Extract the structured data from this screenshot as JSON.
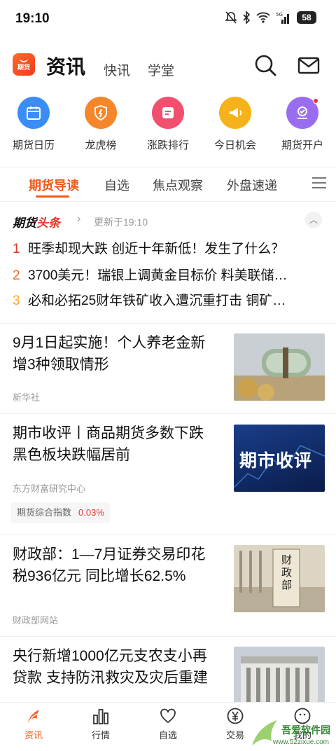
{
  "status": {
    "time": "19:10",
    "battery": "58"
  },
  "header": {
    "title": "资讯",
    "tabs": [
      "快讯",
      "学堂"
    ],
    "logo_text": "期货"
  },
  "quick": [
    {
      "label": "期货日历",
      "color": "#3a8df5",
      "icon": "calendar-icon"
    },
    {
      "label": "龙虎榜",
      "color": "#f5862a",
      "icon": "lightning-badge-icon"
    },
    {
      "label": "涨跌排行",
      "color": "#f0506e",
      "icon": "list-card-icon"
    },
    {
      "label": "今日机会",
      "color": "#f5b21a",
      "icon": "megaphone-icon"
    },
    {
      "label": "期货开户",
      "color": "#9a6df0",
      "icon": "account-icon"
    }
  ],
  "tabs": [
    "期货导读",
    "自选",
    "焦点观察",
    "外盘速递"
  ],
  "headlines": {
    "brand_a": "期货",
    "brand_b": "头条",
    "updated": "更新于19:10",
    "items": [
      {
        "num": "1",
        "text": "旺季却现大跌 创近十年新低！发生了什么？"
      },
      {
        "num": "2",
        "text": "3700美元！瑞银上调黄金目标价 料美联储…"
      },
      {
        "num": "3",
        "text": "必和必拓25财年铁矿收入遭沉重打击 铜矿…"
      }
    ]
  },
  "news": [
    {
      "title": "9月1日起实施！个人养老金新增3种领取情形",
      "source": "新华社"
    },
    {
      "title": "期市收评丨商品期货多数下跌 黑色板块跌幅居前",
      "source": "东方财富研究中心",
      "thumb_text": "期市收评",
      "tag_label": "期货综合指数",
      "tag_value": "0.03%"
    },
    {
      "title": "财政部：1—7月证券交易印花税936亿元 同比增长62.5%",
      "source": "财政部网站",
      "thumb_text": "财政部"
    },
    {
      "title": "央行新增1000亿元支农支小再贷款 支持防汛救灾及灾后重建",
      "source": ""
    }
  ],
  "bottom_nav": [
    "资讯",
    "行情",
    "自选",
    "交易",
    "我的"
  ],
  "watermark": {
    "text": "吾爱软件园",
    "url": "www.52zixue.com"
  },
  "accent": "#f05a1a"
}
